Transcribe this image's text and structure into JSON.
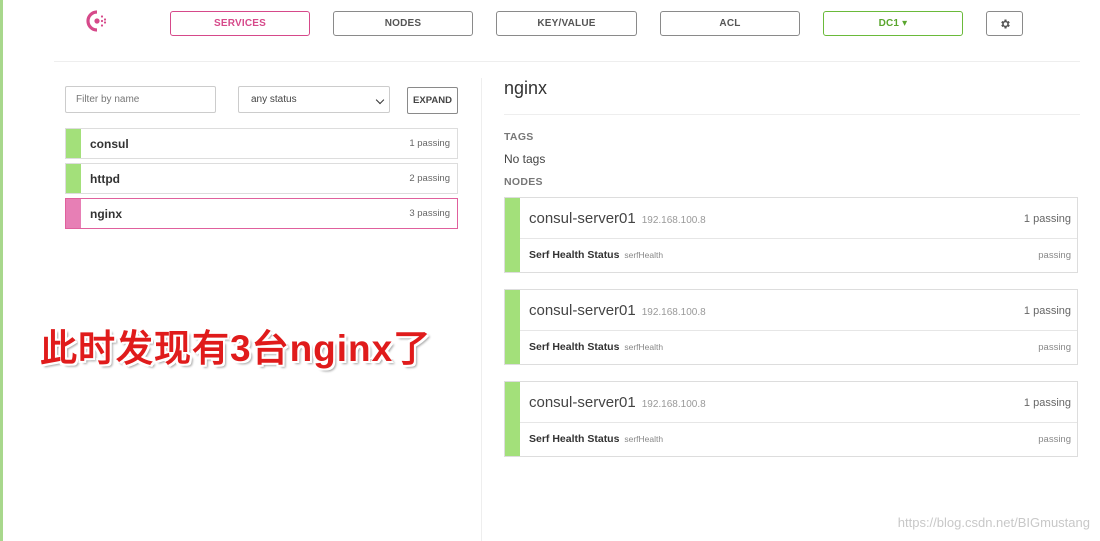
{
  "nav": {
    "services": "SERVICES",
    "nodes": "NODES",
    "keyvalue": "KEY/VALUE",
    "acl": "ACL",
    "dc": "DC1 ▾"
  },
  "filters": {
    "name_placeholder": "Filter by name",
    "status_value": "any status",
    "expand": "EXPAND"
  },
  "services": [
    {
      "name": "consul",
      "status": "1 passing"
    },
    {
      "name": "httpd",
      "status": "2 passing"
    },
    {
      "name": "nginx",
      "status": "3 passing"
    }
  ],
  "annotation": "此时发现有3台nginx了",
  "detail": {
    "title": "nginx",
    "tags_label": "TAGS",
    "tags_value": "No tags",
    "nodes_label": "NODES",
    "nodes": [
      {
        "name": "consul-server01",
        "ip": "192.168.100.8",
        "status": "1 passing",
        "check_name": "Serf Health Status",
        "check_id": "serfHealth",
        "check_status": "passing"
      },
      {
        "name": "consul-server01",
        "ip": "192.168.100.8",
        "status": "1 passing",
        "check_name": "Serf Health Status",
        "check_id": "serfHealth",
        "check_status": "passing"
      },
      {
        "name": "consul-server01",
        "ip": "192.168.100.8",
        "status": "1 passing",
        "check_name": "Serf Health Status",
        "check_id": "serfHealth",
        "check_status": "passing"
      }
    ]
  },
  "watermark": "https://blog.csdn.net/BIGmustang",
  "colors": {
    "brand": "#d6498a",
    "passing": "#a3e07a",
    "selected": "#e77fb5",
    "annotation": "#e01b1b"
  }
}
